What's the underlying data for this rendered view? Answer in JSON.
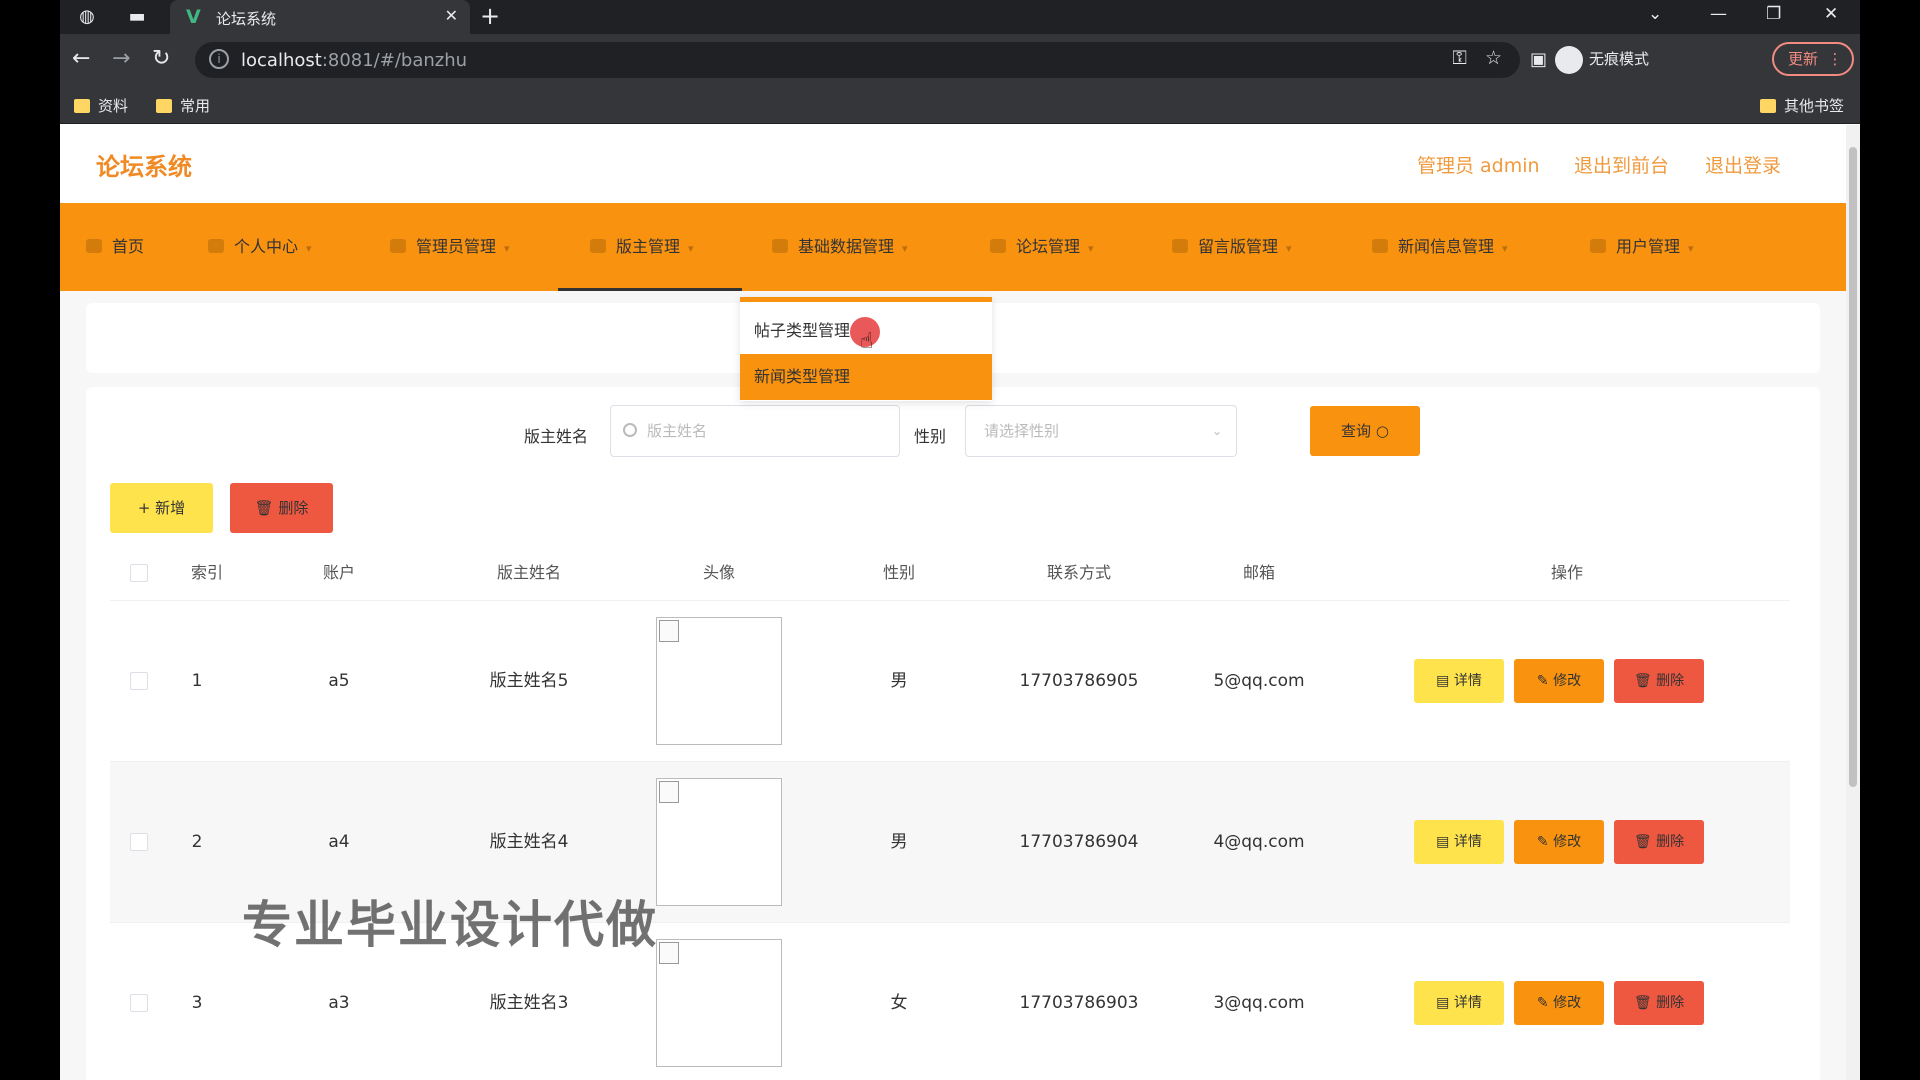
{
  "browser": {
    "tab_title": "论坛系统",
    "tab_favicon": "V",
    "url_host": "localhost",
    "url_rest": ":8081/#/banzhu",
    "profile_label": "无痕模式",
    "update_label": "更新",
    "bookmarks": [
      "资料",
      "常用"
    ],
    "other_bookmarks": "其他书签"
  },
  "header": {
    "logo": "论坛系统",
    "admin_label": "管理员 admin",
    "to_front": "退出到前台",
    "logout": "退出登录",
    "accent": "#f08a24"
  },
  "menu": {
    "items": [
      "首页",
      "个人中心",
      "管理员管理",
      "版主管理",
      "基础数据管理",
      "论坛管理",
      "留言版管理",
      "新闻信息管理",
      "用户管理"
    ],
    "active": "版主管理",
    "bar_color": "#f8920f"
  },
  "dropdown": {
    "items": [
      "帖子类型管理",
      "新闻类型管理"
    ]
  },
  "search": {
    "name_label": "版主姓名",
    "name_placeholder": "版主姓名",
    "gender_label": "性别",
    "gender_placeholder": "请选择性别",
    "query_label": "查询"
  },
  "actions": {
    "add_label": "+ 新增",
    "delete_label": "删除"
  },
  "table": {
    "columns": [
      "索引",
      "账户",
      "版主姓名",
      "头像",
      "性别",
      "联系方式",
      "邮箱",
      "操作"
    ],
    "rows": [
      {
        "index": "1",
        "account": "a5",
        "name": "版主姓名5",
        "gender": "男",
        "phone": "17703786905",
        "email": "5@qq.com"
      },
      {
        "index": "2",
        "account": "a4",
        "name": "版主姓名4",
        "gender": "男",
        "phone": "17703786904",
        "email": "4@qq.com"
      },
      {
        "index": "3",
        "account": "a3",
        "name": "版主姓名3",
        "gender": "女",
        "phone": "17703786903",
        "email": "3@qq.com"
      }
    ],
    "row_actions": {
      "detail": "详情",
      "edit": "修改",
      "delete": "删除"
    }
  },
  "watermark": "专业毕业设计代做"
}
